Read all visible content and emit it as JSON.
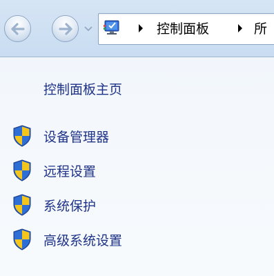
{
  "address_bar": {
    "location_icon": "control-panel-icon",
    "breadcrumbs": [
      "控制面板",
      "所"
    ]
  },
  "navigation": {
    "back_icon": "back-arrow-icon",
    "forward_icon": "forward-arrow-icon",
    "recent_pages_icon": "chevron-down-icon"
  },
  "task_pane": {
    "home_link": "控制面板主页",
    "tasks": [
      {
        "label": "设备管理器",
        "icon": "uac-shield-icon"
      },
      {
        "label": "远程设置",
        "icon": "uac-shield-icon"
      },
      {
        "label": "系统保护",
        "icon": "uac-shield-icon"
      },
      {
        "label": "高级系统设置",
        "icon": "uac-shield-icon"
      }
    ]
  },
  "colors": {
    "link": "#1e3287",
    "nav_background": "#d6e5f5",
    "pane_background": "#eef4fb",
    "shield_blue": "#2a62c9",
    "shield_yellow": "#f4c51c"
  }
}
